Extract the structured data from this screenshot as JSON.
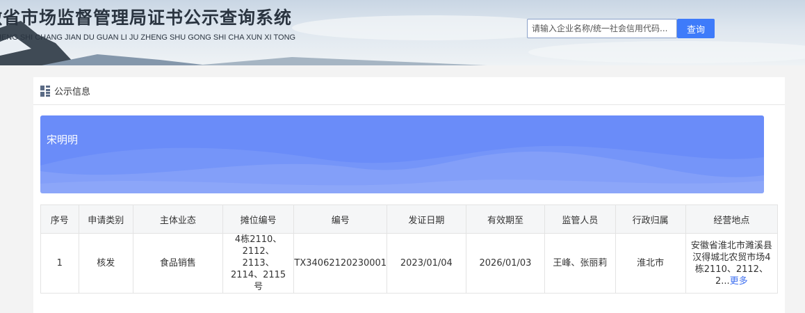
{
  "header": {
    "title": "徽省市场监督管理局证书公示查询系统",
    "subtitle": "HENG SHI CHANG JIAN DU GUAN LI JU ZHENG SHU GONG SHI CHA XUN XI TONG",
    "search_placeholder": "请输入企业名称/统一社会信用代码...",
    "search_button": "查询"
  },
  "panel": {
    "section_title": "公示信息",
    "card_name": "宋明明"
  },
  "table": {
    "columns": [
      "序号",
      "申请类别",
      "主体业态",
      "摊位编号",
      "编号",
      "发证日期",
      "有效期至",
      "监管人员",
      "行政归属",
      "经营地点"
    ],
    "rows": [
      {
        "index": "1",
        "category": "核发",
        "business": "食品销售",
        "stall": "4栋2110、2112、2113、2114、2115号",
        "number": "TX34062120230001",
        "issue_date": "2023/01/04",
        "valid_until": "2026/01/03",
        "inspectors": "王峰、张丽莉",
        "jurisdiction": "淮北市",
        "address": "安徽省淮北市濉溪县汉得城北农贸市场4栋2110、2112、2...",
        "more": "更多"
      }
    ]
  },
  "colors": {
    "accent": "#3e7bfa",
    "card": "#6a8cf9"
  }
}
